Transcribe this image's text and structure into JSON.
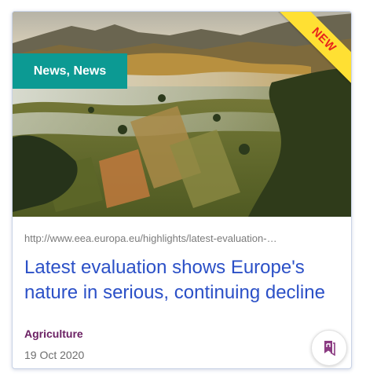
{
  "card": {
    "category_label": "News, News",
    "new_badge": "NEW",
    "url": "http://www.eea.europa.eu/highlights/latest-evaluation-…",
    "title": "Latest evaluation shows Europe's nature in serious, continuing decline",
    "topic": "Agriculture",
    "date": "19 Oct 2020",
    "bookmark_icon": "bookmark-icon"
  },
  "colors": {
    "category_badge": "#0c9a93",
    "new_ribbon": "#ffe033",
    "new_text": "#e8251c",
    "title": "#2b50c7",
    "topic": "#6b2063",
    "bookmark_icon": "#8b3b82"
  }
}
